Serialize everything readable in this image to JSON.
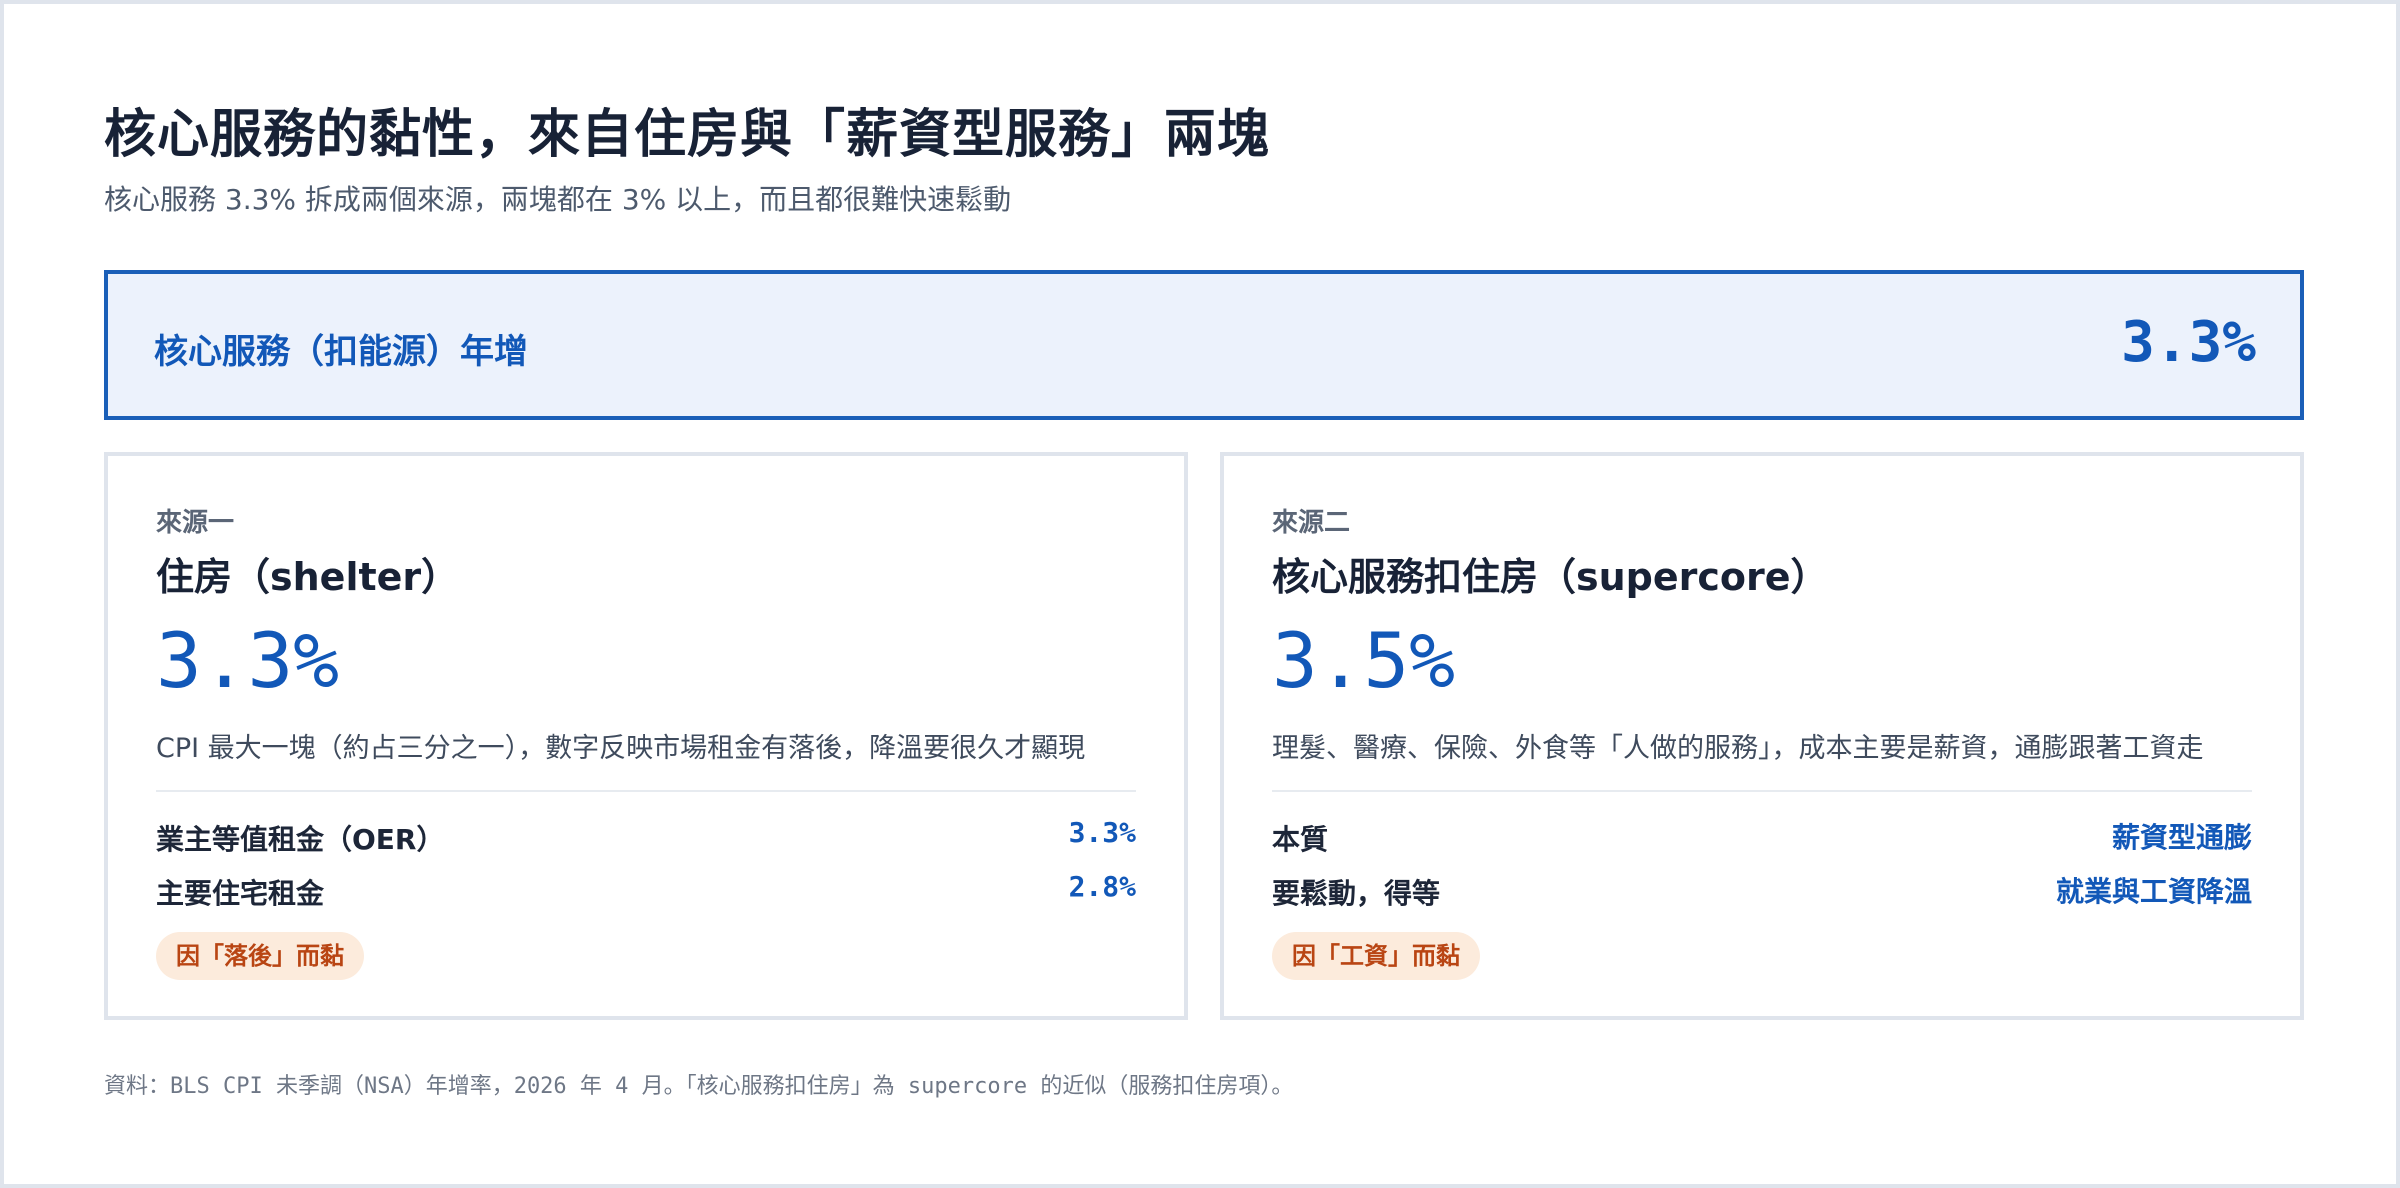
{
  "header": {
    "title": "核心服務的黏性，來自住房與「薪資型服務」兩塊",
    "subtitle": "核心服務 3.3% 拆成兩個來源，兩塊都在 3% 以上，而且都很難快速鬆動"
  },
  "banner": {
    "label": "核心服務（扣能源）年增",
    "value": "3.3%"
  },
  "cards": [
    {
      "kicker": "來源一",
      "title": "住房（shelter）",
      "value": "3.3%",
      "description": "CPI 最大一塊（約占三分之一），數字反映市場租金有落後，降溫要很久才顯現",
      "rows": [
        {
          "label": "業主等值租金（OER）",
          "value": "3.3%"
        },
        {
          "label": "主要住宅租金",
          "value": "2.8%"
        }
      ],
      "tag": "因「落後」而黏"
    },
    {
      "kicker": "來源二",
      "title": "核心服務扣住房（supercore）",
      "value": "3.5%",
      "description": "理髮、醫療、保險、外食等「人做的服務」，成本主要是薪資，通膨跟著工資走",
      "rows": [
        {
          "label": "本質",
          "value": "薪資型通膨"
        },
        {
          "label": "要鬆動，得等",
          "value": "就業與工資降溫"
        }
      ],
      "tag": "因「工資」而黏"
    }
  ],
  "footnote": "資料：BLS CPI 未季調（NSA）年增率，2026 年 4 月。「核心服務扣住房」為 supercore 的近似（服務扣住房項）。",
  "colors": {
    "accent": "#1258b8",
    "banner_bg": "#ecf2fc",
    "tag_bg": "#fcebdc",
    "tag_text": "#b94513"
  }
}
